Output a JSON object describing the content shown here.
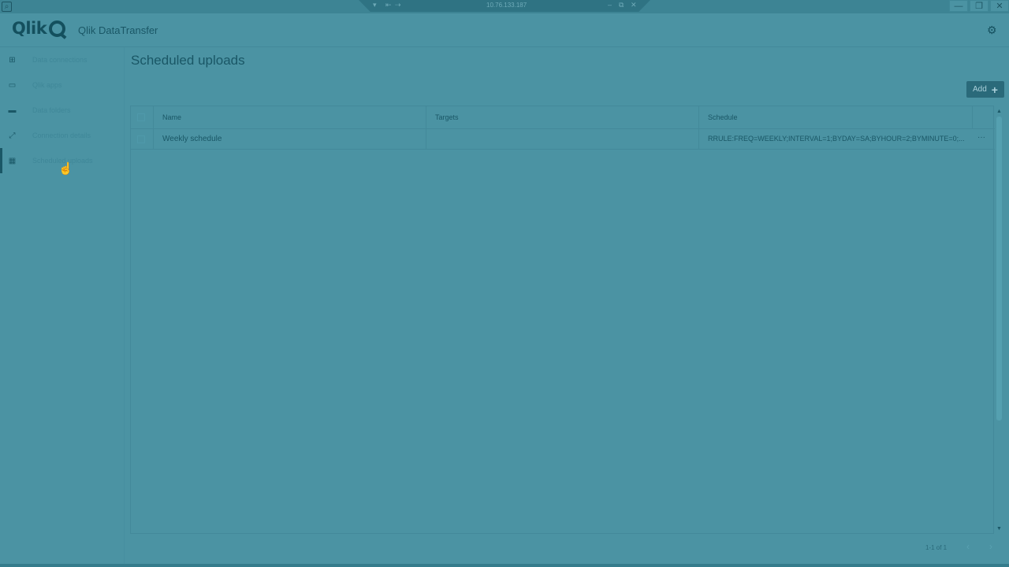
{
  "remote": {
    "address": "10.76.133.187",
    "controls": [
      "▾",
      "⇤",
      "⇢"
    ],
    "center_buttons": [
      "–",
      "⧉",
      "✕"
    ],
    "window_buttons": [
      "—",
      "❐",
      "✕"
    ]
  },
  "header": {
    "logo_text": "Qlik",
    "app_name": "Qlik DataTransfer"
  },
  "sidebar": {
    "items": [
      {
        "label": "Data connections",
        "icon": "data-connections-icon",
        "glyph": "⊞"
      },
      {
        "label": "Qlik apps",
        "icon": "qlik-apps-icon",
        "glyph": "▭"
      },
      {
        "label": "Data folders",
        "icon": "folder-icon",
        "glyph": "▬"
      },
      {
        "label": "Connection details",
        "icon": "connection-icon",
        "glyph": "⤢"
      },
      {
        "label": "Scheduled uploads",
        "icon": "calendar-icon",
        "glyph": "▦"
      }
    ]
  },
  "main": {
    "title": "Scheduled uploads",
    "add_label": "Add",
    "add_plus": "+",
    "table": {
      "columns": [
        "Name",
        "Targets",
        "Schedule"
      ],
      "rows": [
        {
          "name": "Weekly schedule",
          "targets": "",
          "schedule": "RRULE:FREQ=WEEKLY;INTERVAL=1;BYDAY=SA;BYHOUR=2;BYMINUTE=0;..."
        }
      ],
      "row_menu": "···"
    },
    "pagination": {
      "info": "1-1 of 1",
      "prev": "‹",
      "next": "›"
    }
  },
  "colors": {
    "overlay": "#4b93a3",
    "accent": "#1a5766",
    "button": "#2a6a7a"
  }
}
